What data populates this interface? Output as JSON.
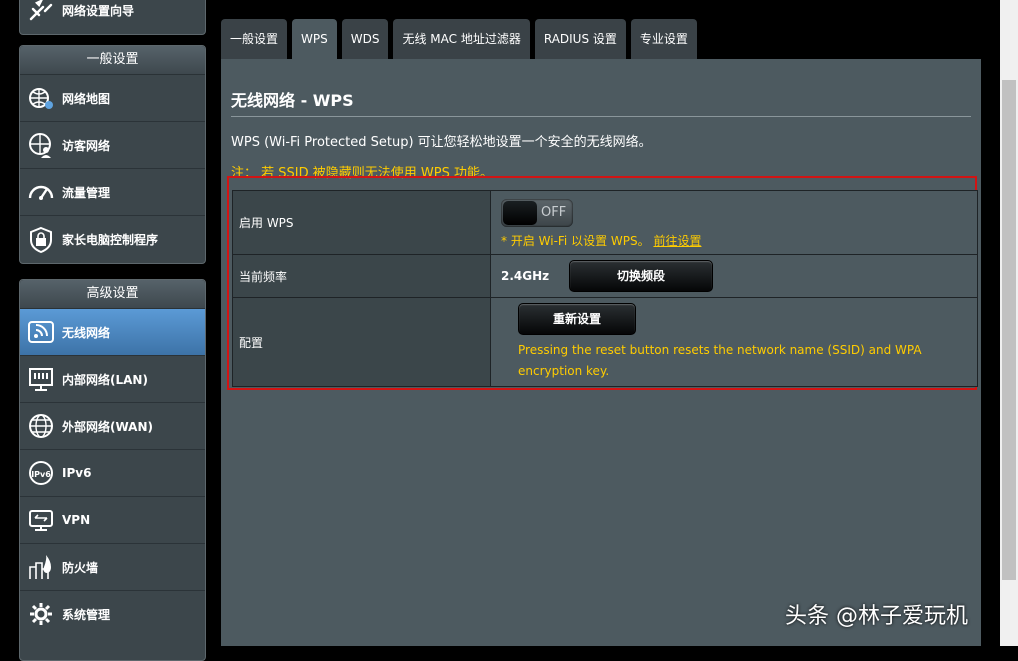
{
  "sidebar": {
    "top_item": {
      "label": "网络设置向导",
      "icon": "wizard-icon"
    },
    "general": {
      "header": "一般设置",
      "items": [
        {
          "label": "网络地图",
          "icon": "network-map-icon"
        },
        {
          "label": "访客网络",
          "icon": "guest-network-icon"
        },
        {
          "label": "流量管理",
          "icon": "traffic-meter-icon"
        },
        {
          "label": "家长电脑控制程序",
          "icon": "parental-lock-icon"
        }
      ]
    },
    "advanced": {
      "header": "高级设置",
      "items": [
        {
          "label": "无线网络",
          "icon": "wireless-icon",
          "active": true
        },
        {
          "label": "内部网络(LAN)",
          "icon": "lan-icon"
        },
        {
          "label": "外部网络(WAN)",
          "icon": "wan-globe-icon"
        },
        {
          "label": "IPv6",
          "icon": "ipv6-icon"
        },
        {
          "label": "VPN",
          "icon": "vpn-icon"
        },
        {
          "label": "防火墙",
          "icon": "firewall-icon"
        },
        {
          "label": "系统管理",
          "icon": "gear-icon"
        }
      ]
    }
  },
  "tabs": [
    {
      "label": "一般设置"
    },
    {
      "label": "WPS",
      "active": true
    },
    {
      "label": "WDS"
    },
    {
      "label": "无线 MAC 地址过滤器"
    },
    {
      "label": "RADIUS 设置"
    },
    {
      "label": "专业设置"
    }
  ],
  "main": {
    "title": "无线网络 - WPS",
    "description": "WPS (Wi-Fi Protected Setup) 可让您轻松地设置一个安全的无线网络。",
    "note": "注： 若 SSID 被隐藏则无法使用 WPS 功能。",
    "rows": {
      "enable": {
        "label": "启用 WPS",
        "switch_state": "OFF",
        "hint_text": "* 开启 Wi-Fi 以设置 WPS。",
        "hint_link": "前往设置"
      },
      "frequency": {
        "label": "当前频率",
        "value": "2.4GHz",
        "button": "切换频段"
      },
      "config": {
        "label": "配置",
        "button": "重新设置",
        "hint": "Pressing the reset button resets the network name (SSID) and WPA encryption key."
      }
    }
  },
  "watermark": "头条 @林子爱玩机",
  "colors": {
    "accent_blue": "#4a86c0",
    "warning_yellow": "#ffcc00",
    "highlight_red": "#d21414",
    "panel": "#4d5a60"
  }
}
